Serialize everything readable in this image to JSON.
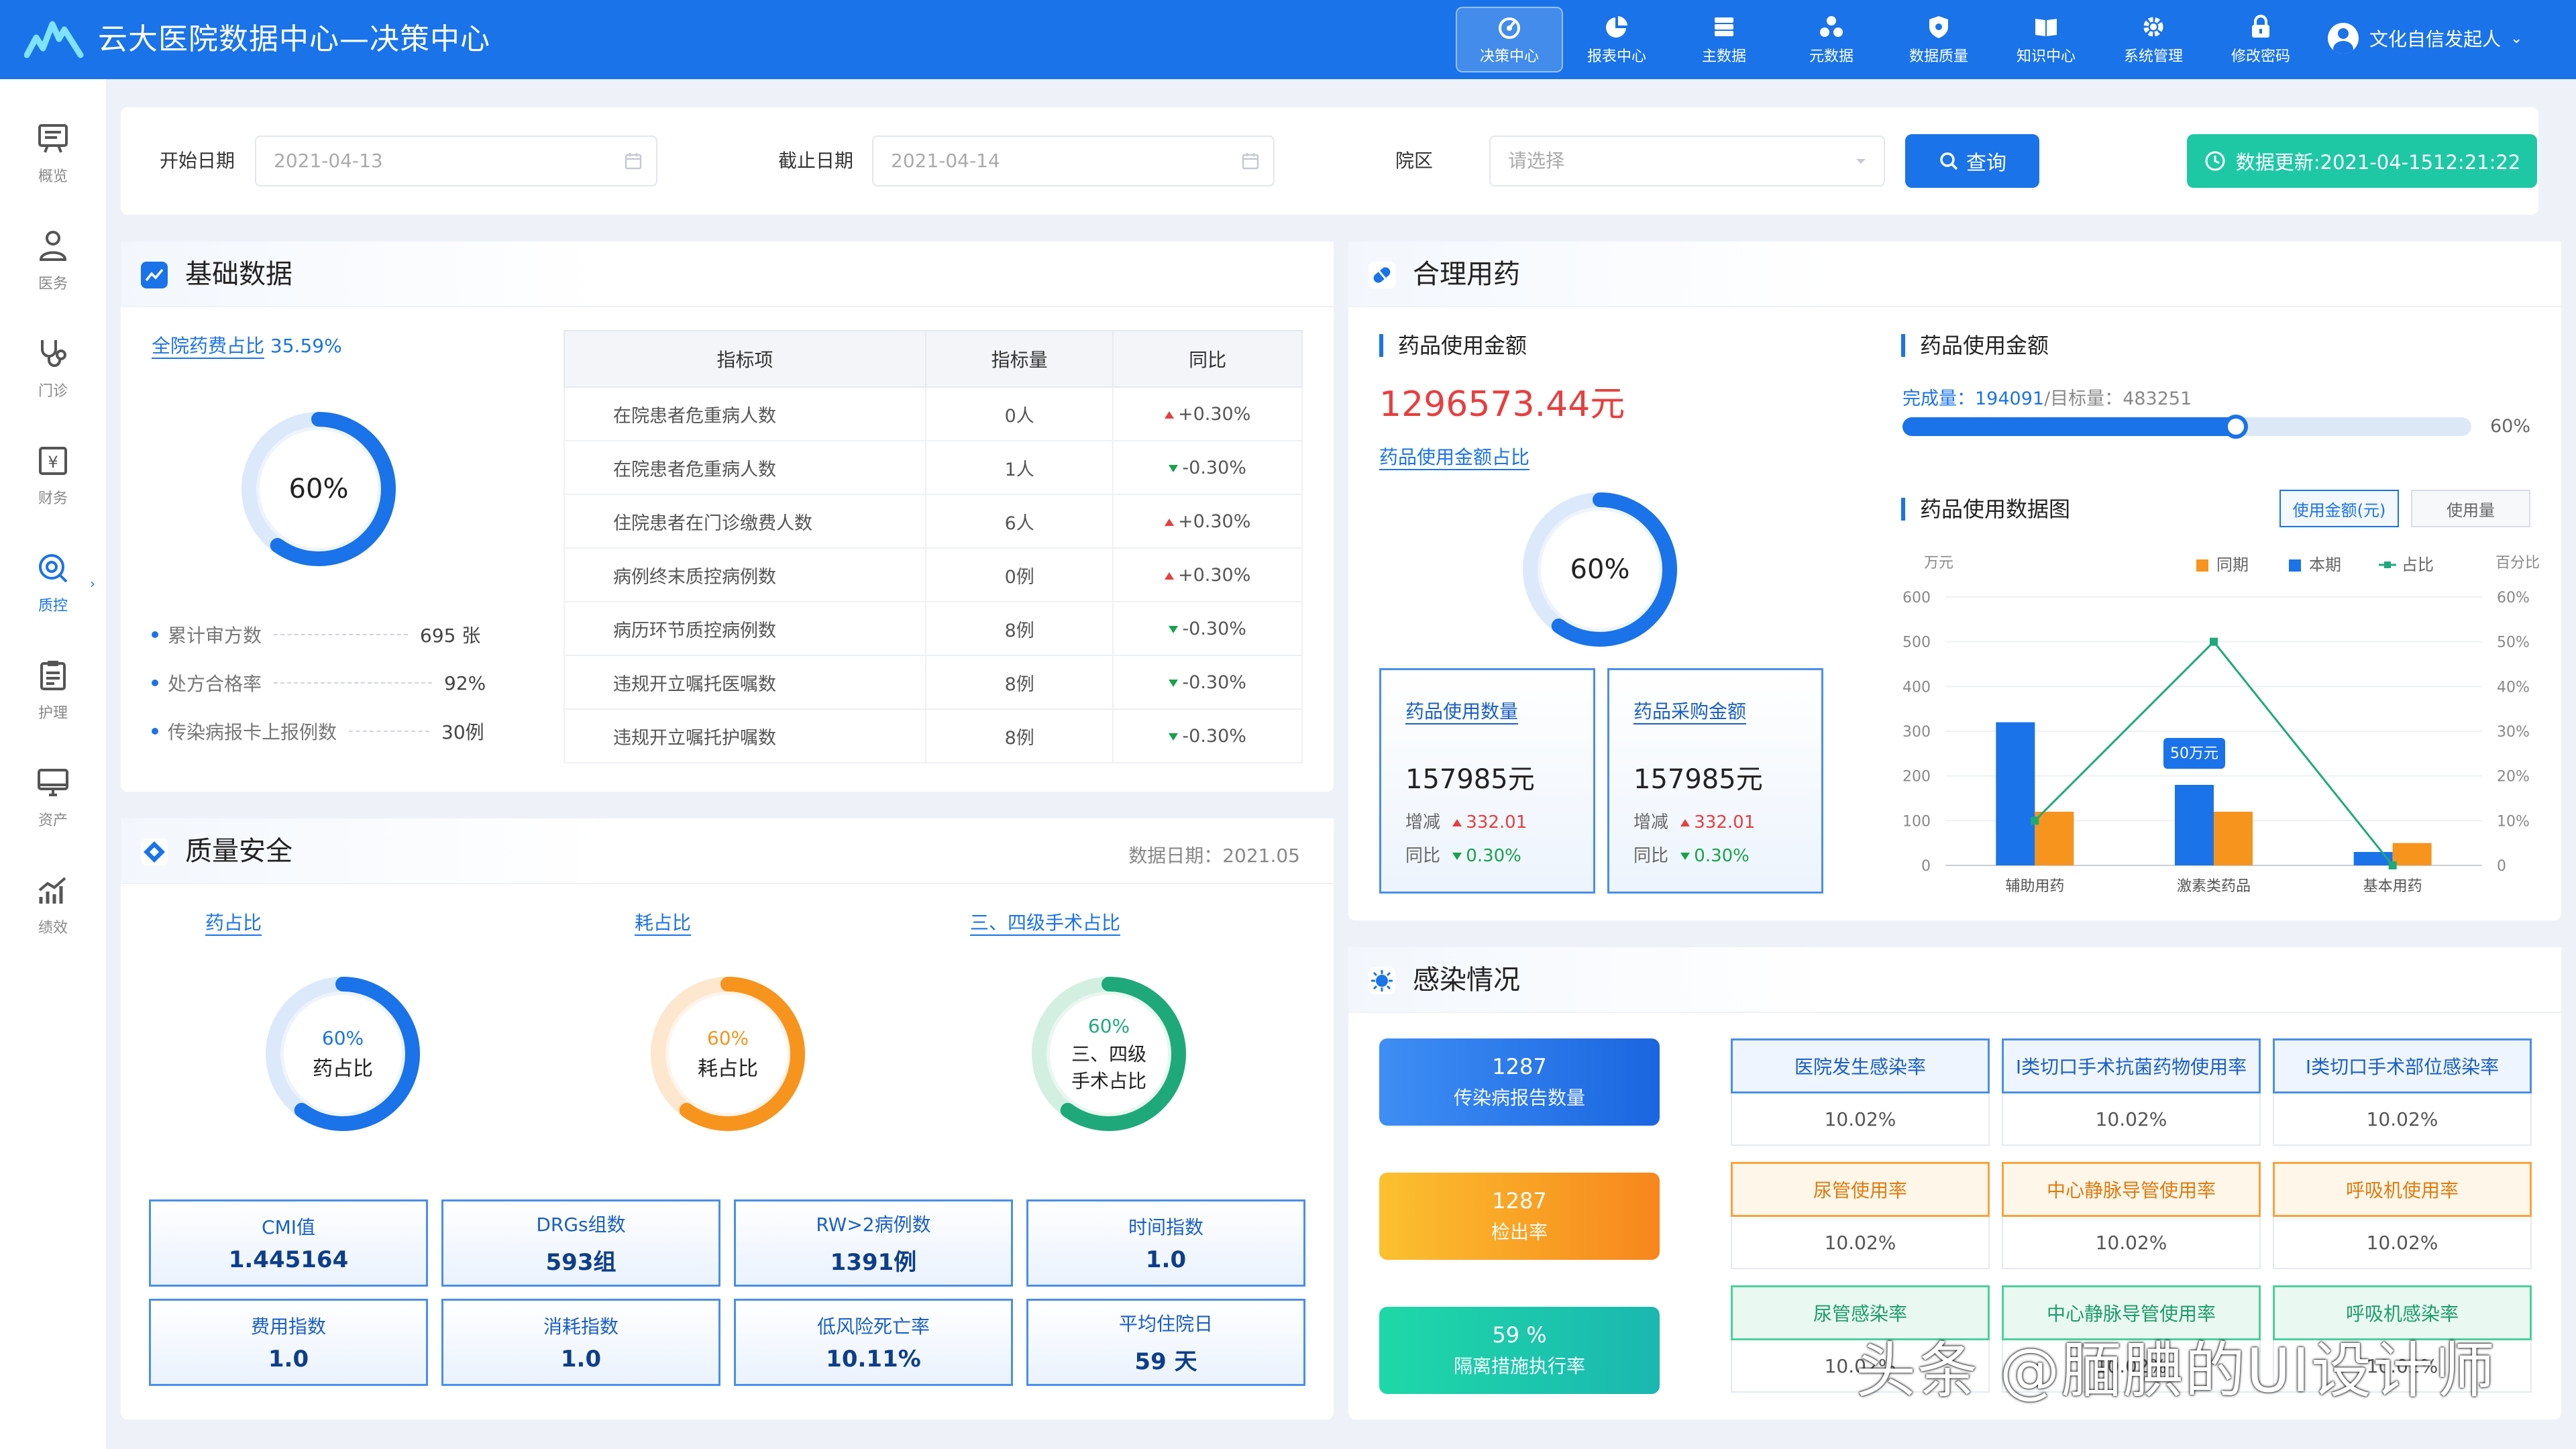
{
  "header": {
    "title": "云大医院数据中心—决策中心",
    "user": "文化自信发起人"
  },
  "nav": [
    {
      "label": "决策中心",
      "icon": "dashboard-icon"
    },
    {
      "label": "报表中心",
      "icon": "pie-chart-icon"
    },
    {
      "label": "主数据",
      "icon": "database-icon"
    },
    {
      "label": "元数据",
      "icon": "cluster-icon"
    },
    {
      "label": "数据质量",
      "icon": "shield-icon"
    },
    {
      "label": "知识中心",
      "icon": "book-icon"
    },
    {
      "label": "系统管理",
      "icon": "gear-icon"
    },
    {
      "label": "修改密码",
      "icon": "lock-icon"
    }
  ],
  "sidebar": [
    {
      "label": "概览",
      "icon": "overview-icon"
    },
    {
      "label": "医务",
      "icon": "doctor-icon"
    },
    {
      "label": "门诊",
      "icon": "stethoscope-icon"
    },
    {
      "label": "财务",
      "icon": "finance-icon"
    },
    {
      "label": "质控",
      "icon": "quality-control-icon"
    },
    {
      "label": "护理",
      "icon": "clipboard-icon"
    },
    {
      "label": "资产",
      "icon": "monitor-icon"
    },
    {
      "label": "绩效",
      "icon": "performance-chart-icon"
    }
  ],
  "filter": {
    "start_label": "开始日期",
    "start_value": "2021-04-13",
    "end_label": "截止日期",
    "end_value": "2021-04-14",
    "campus_label": "院区",
    "campus_placeholder": "请选择",
    "query": "查询",
    "update": "数据更新:2021-04-1512:21:22"
  },
  "basic": {
    "title": "基础数据",
    "drug_ratio_label": "全院药费占比",
    "drug_ratio_value": "35.59%",
    "donut_pct": 60,
    "donut_text": "60%",
    "legend": [
      {
        "label": "累计审方数",
        "value": "695 张"
      },
      {
        "label": "处方合格率",
        "value": "92%"
      },
      {
        "label": "传染病报卡上报例数",
        "value": "30例"
      }
    ],
    "table_headers": [
      "指标项",
      "指标量",
      "同比"
    ],
    "rows": [
      {
        "name": "在院患者危重病人数",
        "value": "0人",
        "yoy": "+0.30%",
        "dir": "up"
      },
      {
        "name": "在院患者危重病人数",
        "value": "1人",
        "yoy": "-0.30%",
        "dir": "down"
      },
      {
        "name": "住院患者在门诊缴费人数",
        "value": "6人",
        "yoy": "+0.30%",
        "dir": "up"
      },
      {
        "name": "病例终末质控病例数",
        "value": "0例",
        "yoy": "+0.30%",
        "dir": "up"
      },
      {
        "name": "病历环节质控病例数",
        "value": "8例",
        "yoy": "-0.30%",
        "dir": "down"
      },
      {
        "name": "违规开立嘱托医嘱数",
        "value": "8例",
        "yoy": "-0.30%",
        "dir": "down"
      },
      {
        "name": "违规开立嘱托护嘱数",
        "value": "8例",
        "yoy": "-0.30%",
        "dir": "down"
      }
    ]
  },
  "quality": {
    "title": "质量安全",
    "date": "数据日期：2021.05",
    "donuts": [
      {
        "link": "药占比",
        "pct": 60,
        "text": "60%",
        "sub": "药占比",
        "color": "#1a73e8"
      },
      {
        "link": "耗占比",
        "pct": 60,
        "text": "60%",
        "sub": "耗占比",
        "color": "#f7941d"
      },
      {
        "link": "三、四级手术占比",
        "pct": 60,
        "text": "60%",
        "sub": "三、四级",
        "sub2": "手术占比",
        "color": "#1fa97a"
      }
    ],
    "metrics": [
      {
        "label": "CMI值",
        "value": "1.445164"
      },
      {
        "label": "DRGs组数",
        "value": "593组"
      },
      {
        "label": "RW>2病例数",
        "value": "1391例"
      },
      {
        "label": "时间指数",
        "value": "1.0"
      },
      {
        "label": "费用指数",
        "value": "1.0"
      },
      {
        "label": "消耗指数",
        "value": "1.0"
      },
      {
        "label": "低风险死亡率",
        "value": "10.11%"
      },
      {
        "label": "平均住院日",
        "value": "59 天"
      }
    ]
  },
  "drug": {
    "title": "合理用药",
    "amount_label": "药品使用金额",
    "amount": "1296573.44元",
    "ratio_link": "药品使用金额占比",
    "donut_pct": 60,
    "donut_text": "60%",
    "cards": [
      {
        "title": "药品使用数量",
        "value": "157985元",
        "inc_label": "增减",
        "inc": "332.01",
        "yoy_label": "同比",
        "yoy": "0.30%"
      },
      {
        "title": "药品采购金额",
        "value": "157985元",
        "inc_label": "增减",
        "inc": "332.01",
        "yoy_label": "同比",
        "yoy": "0.30%"
      }
    ],
    "target_label": "药品使用金额",
    "done_label": "完成量：",
    "done": "194091",
    "target_text": "/目标量：",
    "target": "483251",
    "progress_pct": 60,
    "progress_text": "60%",
    "chart_title": "药品使用数据图",
    "btn_amount": "使用金额(元)",
    "btn_qty": "使用量"
  },
  "infection": {
    "title": "感染情况",
    "big": [
      {
        "value": "1287",
        "label": "传染病报告数量"
      },
      {
        "value": "1287",
        "label": "检出率"
      },
      {
        "value": "59 %",
        "label": "隔离措施执行率"
      }
    ],
    "cells": [
      {
        "label": "医院发生感染率",
        "value": "10.02%"
      },
      {
        "label": "Ⅰ类切口手术抗菌药物使用率",
        "value": "10.02%"
      },
      {
        "label": "Ⅰ类切口手术部位感染率",
        "value": "10.02%"
      },
      {
        "label": "尿管使用率",
        "value": "10.02%"
      },
      {
        "label": "中心静脉导管使用率",
        "value": "10.02%"
      },
      {
        "label": "呼吸机使用率",
        "value": "10.02%"
      },
      {
        "label": "尿管感染率",
        "value": "10.02%"
      },
      {
        "label": "中心静脉导管使用率",
        "value": "10.02%"
      },
      {
        "label": "呼吸机感染率",
        "value": "10.02%"
      }
    ]
  },
  "chart_data": {
    "type": "bar",
    "categories": [
      "辅助用药",
      "激素类药品",
      "基本用药"
    ],
    "series": [
      {
        "name": "同期",
        "values": [
          120,
          120,
          50
        ],
        "color": "#f7941d"
      },
      {
        "name": "本期",
        "values": [
          320,
          180,
          30
        ],
        "color": "#1a73e8"
      },
      {
        "name": "占比",
        "type": "line",
        "values": [
          10,
          50,
          0
        ],
        "color": "#1fa97a"
      }
    ],
    "ylabel": "万元",
    "y2label": "百分比",
    "ylim": [
      0,
      600
    ],
    "y2lim": [
      0,
      60
    ],
    "yticks": [
      "0",
      "100",
      "200",
      "300",
      "400",
      "500",
      "600"
    ],
    "y2ticks": [
      "0",
      "10%",
      "20%",
      "30%",
      "40%",
      "50%",
      "60%"
    ],
    "annotation": "50万元",
    "legend_position": "top-right"
  },
  "watermark": "头条 @腼腆的UI设计师",
  "colors": {
    "primary": "#1a73e8",
    "accent_green": "#1ec8a5",
    "red": "#e83e3e",
    "orange": "#f7941d",
    "green": "#1fa97a"
  }
}
